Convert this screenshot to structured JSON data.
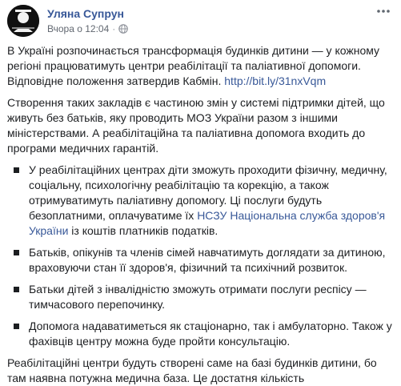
{
  "author": {
    "name": "Уляна Супрун"
  },
  "meta": {
    "time": "Вчора о 12:04",
    "separator": "·",
    "audience_icon": "globe-icon"
  },
  "menu": {
    "icon": "more-horizontal-icon"
  },
  "paragraphs": {
    "p1_text": "В Україні розпочинається трансформація будинків дитини — у кожному регіоні працюватимуть центри реабілітації та паліативної допомоги. Відповідне положення затвердив Кабмін. ",
    "p1_link": "http://bit.ly/31nxVqm",
    "p2": "Створення таких закладів є частиною змін у системі підтримки дітей, що живуть без батьків, яку проводить МОЗ України разом з іншими міністерствами. А реабілітаційна та паліативна допомога входить до програми медичних гарантій.",
    "b1_before": "У реабілітаційних центрах діти зможуть проходити фізичну, медичну, соціальну, психологічну реабілітацію та корекцію, а також отримуватимуть паліативну допомогу. Ці послуги будуть безоплатними, оплачуватиме їх ",
    "b1_link": "НСЗУ Національна служба здоров'я України",
    "b1_after": " із коштів платників податків.",
    "b2": "Батьків, опікунів та членів сімей навчатимуть доглядати за дитиною, враховуючи стан її здоров'я, фізичний та психічний розвиток.",
    "b3": "Батьки дітей з інвалідністю зможуть отримати послуги респісу — тимчасового перепочинку.",
    "b4": "Допомога надаватиметься як стаціонарно, так і амбулаторно. Також у фахівців центру можна буде пройти консультацію.",
    "p3": "Реабілітаційні центри будуть створені саме на базі будинків дитини, бо там наявна потужна медична база. Це достатня кількість"
  },
  "colors": {
    "link": "#385898",
    "text": "#1c1e21",
    "meta": "#616770"
  }
}
